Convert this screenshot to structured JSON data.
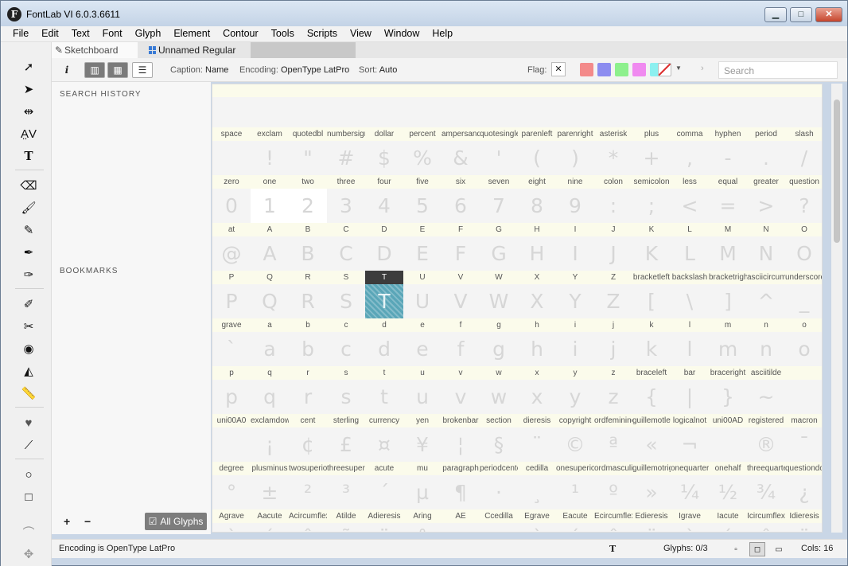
{
  "window": {
    "title": "FontLab VI 6.0.3.6611",
    "app_icon": "F",
    "min": "▁",
    "max": "□",
    "close": "✕"
  },
  "menu": [
    "File",
    "Edit",
    "Text",
    "Font",
    "Glyph",
    "Element",
    "Contour",
    "Tools",
    "Scripts",
    "View",
    "Window",
    "Help"
  ],
  "tabs": {
    "sketchboard": "Sketchboard",
    "font": "Unnamed Regular"
  },
  "toolbar": {
    "info": "i",
    "caption_label": "Caption:",
    "caption_value": "Name",
    "encoding_label": "Encoding:",
    "encoding_value": "OpenType LatPro",
    "sort_label": "Sort:",
    "sort_value": "Auto",
    "flag_label": "Flag:",
    "flag_clear": "✕",
    "flag_colors": [
      "#f38a8a",
      "#8c8cf0",
      "#8df08d",
      "#f08af0",
      "#8cf0f0"
    ],
    "search_placeholder": "Search"
  },
  "sidepanel": {
    "search_history": "SEARCH HISTORY",
    "bookmarks": "BOOKMARKS",
    "add": "+",
    "remove": "−",
    "all_glyphs": "All Glyphs"
  },
  "glyphs": [
    [
      [
        "space",
        ""
      ],
      [
        "exclam",
        "!"
      ],
      [
        "quotedbl",
        "\""
      ],
      [
        "numbersign",
        "#"
      ],
      [
        "dollar",
        "$"
      ],
      [
        "percent",
        "%"
      ],
      [
        "ampersand",
        "&"
      ],
      [
        "quotesingle",
        "'"
      ],
      [
        "parenleft",
        "("
      ],
      [
        "parenright",
        ")"
      ],
      [
        "asterisk",
        "*"
      ],
      [
        "plus",
        "+"
      ],
      [
        "comma",
        ","
      ],
      [
        "hyphen",
        "-"
      ],
      [
        "period",
        "."
      ],
      [
        "slash",
        "/"
      ]
    ],
    [
      [
        "zero",
        "0"
      ],
      [
        "one",
        "1"
      ],
      [
        "two",
        "2"
      ],
      [
        "three",
        "3"
      ],
      [
        "four",
        "4"
      ],
      [
        "five",
        "5"
      ],
      [
        "six",
        "6"
      ],
      [
        "seven",
        "7"
      ],
      [
        "eight",
        "8"
      ],
      [
        "nine",
        "9"
      ],
      [
        "colon",
        ":"
      ],
      [
        "semicolon",
        ";"
      ],
      [
        "less",
        "<"
      ],
      [
        "equal",
        "="
      ],
      [
        "greater",
        ">"
      ],
      [
        "question",
        "?"
      ]
    ],
    [
      [
        "at",
        "@"
      ],
      [
        "A",
        "A"
      ],
      [
        "B",
        "B"
      ],
      [
        "C",
        "C"
      ],
      [
        "D",
        "D"
      ],
      [
        "E",
        "E"
      ],
      [
        "F",
        "F"
      ],
      [
        "G",
        "G"
      ],
      [
        "H",
        "H"
      ],
      [
        "I",
        "I"
      ],
      [
        "J",
        "J"
      ],
      [
        "K",
        "K"
      ],
      [
        "L",
        "L"
      ],
      [
        "M",
        "M"
      ],
      [
        "N",
        "N"
      ],
      [
        "O",
        "O"
      ]
    ],
    [
      [
        "P",
        "P"
      ],
      [
        "Q",
        "Q"
      ],
      [
        "R",
        "R"
      ],
      [
        "S",
        "S"
      ],
      [
        "T",
        "T"
      ],
      [
        "U",
        "U"
      ],
      [
        "V",
        "V"
      ],
      [
        "W",
        "W"
      ],
      [
        "X",
        "X"
      ],
      [
        "Y",
        "Y"
      ],
      [
        "Z",
        "Z"
      ],
      [
        "bracketleft",
        "["
      ],
      [
        "backslash",
        "\\"
      ],
      [
        "bracketright",
        "]"
      ],
      [
        "asciicircum",
        "^"
      ],
      [
        "underscore",
        "_"
      ]
    ],
    [
      [
        "grave",
        "`"
      ],
      [
        "a",
        "a"
      ],
      [
        "b",
        "b"
      ],
      [
        "c",
        "c"
      ],
      [
        "d",
        "d"
      ],
      [
        "e",
        "e"
      ],
      [
        "f",
        "f"
      ],
      [
        "g",
        "g"
      ],
      [
        "h",
        "h"
      ],
      [
        "i",
        "i"
      ],
      [
        "j",
        "j"
      ],
      [
        "k",
        "k"
      ],
      [
        "l",
        "l"
      ],
      [
        "m",
        "m"
      ],
      [
        "n",
        "n"
      ],
      [
        "o",
        "o"
      ]
    ],
    [
      [
        "p",
        "p"
      ],
      [
        "q",
        "q"
      ],
      [
        "r",
        "r"
      ],
      [
        "s",
        "s"
      ],
      [
        "t",
        "t"
      ],
      [
        "u",
        "u"
      ],
      [
        "v",
        "v"
      ],
      [
        "w",
        "w"
      ],
      [
        "x",
        "x"
      ],
      [
        "y",
        "y"
      ],
      [
        "z",
        "z"
      ],
      [
        "braceleft",
        "{"
      ],
      [
        "bar",
        "|"
      ],
      [
        "braceright",
        "}"
      ],
      [
        "asciitilde",
        "~"
      ],
      [
        "",
        ""
      ]
    ],
    [
      [
        "uni00A0",
        ""
      ],
      [
        "exclamdown",
        "¡"
      ],
      [
        "cent",
        "¢"
      ],
      [
        "sterling",
        "£"
      ],
      [
        "currency",
        "¤"
      ],
      [
        "yen",
        "¥"
      ],
      [
        "brokenbar",
        "¦"
      ],
      [
        "section",
        "§"
      ],
      [
        "dieresis",
        "¨"
      ],
      [
        "copyright",
        "©"
      ],
      [
        "ordfeminine",
        "ª"
      ],
      [
        "guillemotleft",
        "«"
      ],
      [
        "logicalnot",
        "¬"
      ],
      [
        "uni00AD",
        ""
      ],
      [
        "registered",
        "®"
      ],
      [
        "macron",
        "¯"
      ]
    ],
    [
      [
        "degree",
        "°"
      ],
      [
        "plusminus",
        "±"
      ],
      [
        "twosuperior",
        "²"
      ],
      [
        "threesuperior",
        "³"
      ],
      [
        "acute",
        "´"
      ],
      [
        "mu",
        "µ"
      ],
      [
        "paragraph",
        "¶"
      ],
      [
        "periodcentered",
        "·"
      ],
      [
        "cedilla",
        "¸"
      ],
      [
        "onesuperior",
        "¹"
      ],
      [
        "ordmasculine",
        "º"
      ],
      [
        "guillemotright",
        "»"
      ],
      [
        "onequarter",
        "¼"
      ],
      [
        "onehalf",
        "½"
      ],
      [
        "threequarters",
        "¾"
      ],
      [
        "questiondown",
        "¿"
      ]
    ],
    [
      [
        "Agrave",
        "À"
      ],
      [
        "Aacute",
        "Á"
      ],
      [
        "Acircumflex",
        "Â"
      ],
      [
        "Atilde",
        "Ã"
      ],
      [
        "Adieresis",
        "Ä"
      ],
      [
        "Aring",
        "Å"
      ],
      [
        "AE",
        "Æ"
      ],
      [
        "Ccedilla",
        "Ç"
      ],
      [
        "Egrave",
        "È"
      ],
      [
        "Eacute",
        "É"
      ],
      [
        "Ecircumflex",
        "Ê"
      ],
      [
        "Edieresis",
        "Ë"
      ],
      [
        "Igrave",
        "Ì"
      ],
      [
        "Iacute",
        "Í"
      ],
      [
        "Icircumflex",
        "Î"
      ],
      [
        "Idieresis",
        "Ï"
      ]
    ]
  ],
  "selected_glyph": "T",
  "white_glyphs": [
    "one",
    "two"
  ],
  "status": {
    "message": "Encoding is OpenType LatPro",
    "current_glyph": "T",
    "glyphs": "Glyphs: 0/3",
    "cols": "Cols: 16"
  }
}
